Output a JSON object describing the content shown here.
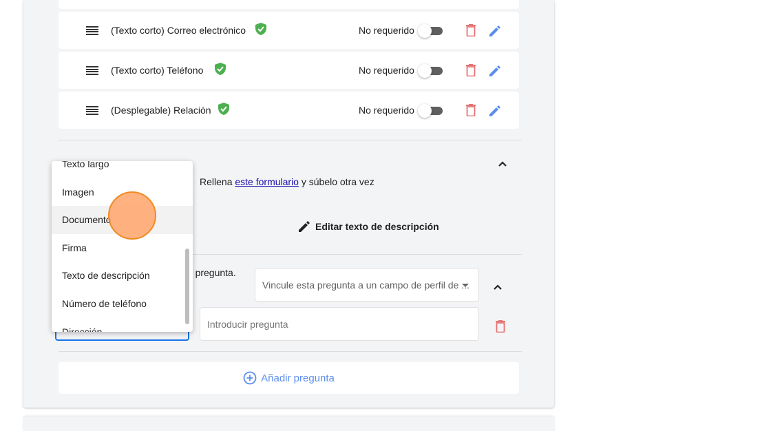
{
  "questions": [
    {
      "title": "(Texto corto) Correo electrónico",
      "required_label": "No requerido"
    },
    {
      "title": "(Texto corto) Teléfono",
      "required_label": "No requerido"
    },
    {
      "title": "(Desplegable) Relación",
      "required_label": "No requerido"
    }
  ],
  "colors": {
    "verified": "#4caf50",
    "delete": "#e57373",
    "edit": "#5b8def",
    "focus": "#1a73e8",
    "touch": "#ffa66e"
  },
  "description": {
    "fill_prefix": "Rellena",
    "fill_link": "este formulario",
    "fill_suffix": "y súbelo otra vez",
    "edit_button": "Editar texto de descripción"
  },
  "link_question": {
    "label_fragment": "ta pregunta.",
    "select_value": "Vincule esta pregunta a un campo de perfil de ..."
  },
  "new_question": {
    "placeholder": "Introducir pregunta"
  },
  "add_question": "Añadir pregunta",
  "type_dropdown": {
    "options": [
      "Texto largo",
      "Imagen",
      "Documento",
      "Firma",
      "Texto de descripción",
      "Número de teléfono",
      "Dirección"
    ],
    "hovered": "Documento"
  },
  "icons": {
    "drag": "drag-handle-icon",
    "verified": "shield-check-icon",
    "delete": "trash-icon",
    "edit": "pencil-icon",
    "collapse": "chevron-up-icon",
    "add": "plus-circle-icon"
  }
}
